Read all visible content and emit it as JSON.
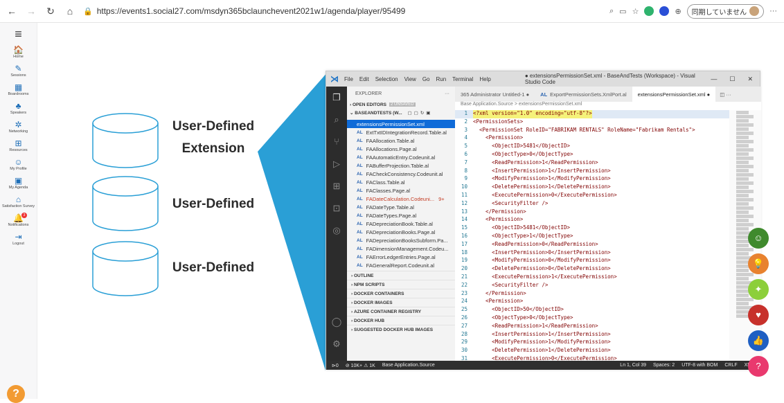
{
  "browser": {
    "url": "https://events1.social27.com/msdyn365bclaunchevent2021w1/agenda/player/95499",
    "profile_label": "同期していません"
  },
  "left_nav": {
    "items": [
      {
        "label": "Home",
        "icon": "home-icon",
        "glyph": "🏠"
      },
      {
        "label": "Sessions",
        "icon": "pen-icon",
        "glyph": "✎"
      },
      {
        "label": "Boardrooms",
        "icon": "boardroom-icon",
        "glyph": "▦"
      },
      {
        "label": "Speakers",
        "icon": "speakers-icon",
        "glyph": "♣"
      },
      {
        "label": "Networking",
        "icon": "networking-icon",
        "glyph": "✲"
      },
      {
        "label": "Resources",
        "icon": "resources-icon",
        "glyph": "⊞"
      },
      {
        "label": "My Profile",
        "icon": "profile-icon",
        "glyph": "☺"
      },
      {
        "label": "My Agenda",
        "icon": "agenda-icon",
        "glyph": "▣"
      },
      {
        "label": "Satisfaction Survey",
        "icon": "survey-icon",
        "glyph": "⌂"
      },
      {
        "label": "Notifications",
        "icon": "bell-icon",
        "glyph": "🔔"
      },
      {
        "label": "Logout",
        "icon": "logout-icon",
        "glyph": "⇥"
      }
    ],
    "notification_count": "3",
    "help_label": "?"
  },
  "slide": {
    "labels": [
      "User-Defined\nExtension",
      "User-Defined",
      "User-Defined"
    ],
    "accent_color": "#2a9fd6"
  },
  "vscode": {
    "menu": [
      "File",
      "Edit",
      "Selection",
      "View",
      "Go",
      "Run",
      "Terminal",
      "Help"
    ],
    "window_title": "● extensionsPermissionSet.xml - BaseAndTests (Workspace) - Visual Studio Code",
    "explorer_label": "EXPLORER",
    "open_editors": "OPEN EDITORS",
    "unsaved": "2 UNSAVED",
    "workspace": "BASEANDTESTS (W...",
    "files": [
      {
        "name": "extensionsPermissionSet.xml",
        "al": false,
        "active": true
      },
      {
        "name": "ExtTxtIDIntegrationRecord.Table.al",
        "al": true
      },
      {
        "name": "FAAllocation.Table.al",
        "al": true
      },
      {
        "name": "FAAllocations.Page.al",
        "al": true
      },
      {
        "name": "FAAutomaticEntry.Codeunit.al",
        "al": true
      },
      {
        "name": "FABufferProjection.Table.al",
        "al": true
      },
      {
        "name": "FACheckConsistency.Codeunit.al",
        "al": true
      },
      {
        "name": "FAClass.Table.al",
        "al": true
      },
      {
        "name": "FAClasses.Page.al",
        "al": true
      },
      {
        "name": "FADateCalculation.Codeuni...",
        "al": true,
        "err": true,
        "count": "9+"
      },
      {
        "name": "FADateType.Table.al",
        "al": true
      },
      {
        "name": "FADateTypes.Page.al",
        "al": true
      },
      {
        "name": "FADepreciationBook.Table.al",
        "al": true
      },
      {
        "name": "FADepreciationBooks.Page.al",
        "al": true
      },
      {
        "name": "FADepreciationBooksSubform.Pa...",
        "al": true
      },
      {
        "name": "FADimensionManagement.Codeu...",
        "al": true
      },
      {
        "name": "FAErrorLedgerEntries.Page.al",
        "al": true
      },
      {
        "name": "FAGeneralReport.Codeunit.al",
        "al": true
      }
    ],
    "sections": [
      "OUTLINE",
      "NPM SCRIPTS",
      "DOCKER CONTAINERS",
      "DOCKER IMAGES",
      "AZURE CONTAINER REGISTRY",
      "DOCKER HUB",
      "SUGGESTED DOCKER HUB IMAGES"
    ],
    "tabs": [
      {
        "label": "365 Administrator  Untitled-1 ●",
        "al": false
      },
      {
        "label": "ExportPermissionSets.XmlPort.al",
        "al": true
      },
      {
        "label": "extensionsPermissionSet.xml ●",
        "al": false,
        "on": true
      }
    ],
    "breadcrumb": "Base Application.Source > extensionsPermissionSet.xml",
    "code": [
      "<?xml version=\"1.0\" encoding=\"utf-8\"?>",
      "<PermissionSets>",
      "  <PermissionSet RoleID=\"FABRIKAM RENTALS\" RoleName=\"Fabrikam Rentals\">",
      "    <Permission>",
      "      <ObjectID>5481</ObjectID>",
      "      <ObjectType>0</ObjectType>",
      "      <ReadPermission>1</ReadPermission>",
      "      <InsertPermission>1</InsertPermission>",
      "      <ModifyPermission>1</ModifyPermission>",
      "      <DeletePermission>1</DeletePermission>",
      "      <ExecutePermission>0</ExecutePermission>",
      "      <SecurityFilter />",
      "    </Permission>",
      "    <Permission>",
      "      <ObjectID>5481</ObjectID>",
      "      <ObjectType>1</ObjectType>",
      "      <ReadPermission>0</ReadPermission>",
      "      <InsertPermission>0</InsertPermission>",
      "      <ModifyPermission>0</ModifyPermission>",
      "      <DeletePermission>0</DeletePermission>",
      "      <ExecutePermission>1</ExecutePermission>",
      "      <SecurityFilter />",
      "    </Permission>",
      "    <Permission>",
      "      <ObjectID>50</ObjectID>",
      "      <ObjectType>0</ObjectType>",
      "      <ReadPermission>1</ReadPermission>",
      "      <InsertPermission>1</InsertPermission>",
      "      <ModifyPermission>1</ModifyPermission>",
      "      <DeletePermission>1</DeletePermission>",
      "      <ExecutePermission>0</ExecutePermission>"
    ],
    "status": {
      "left": [
        "⊘ 10K+  ⚠ 1K",
        "Base Application.Source"
      ],
      "right": [
        "Ln 1, Col 39",
        "Spaces: 2",
        "UTF-8 with BOM",
        "CRLF",
        "XML"
      ]
    }
  },
  "reactions": [
    {
      "icon": "smile-icon",
      "glyph": "☺",
      "color": "#3f8a2d"
    },
    {
      "icon": "bulb-icon",
      "glyph": "💡",
      "color": "#e8822f"
    },
    {
      "icon": "celebrate-icon",
      "glyph": "✦",
      "color": "#8ccf3a"
    },
    {
      "icon": "heart-icon",
      "glyph": "♥",
      "color": "#c7312b"
    },
    {
      "icon": "like-icon",
      "glyph": "👍",
      "color": "#1f5fc2"
    },
    {
      "icon": "question-icon",
      "glyph": "?",
      "color": "#e9396e"
    }
  ]
}
